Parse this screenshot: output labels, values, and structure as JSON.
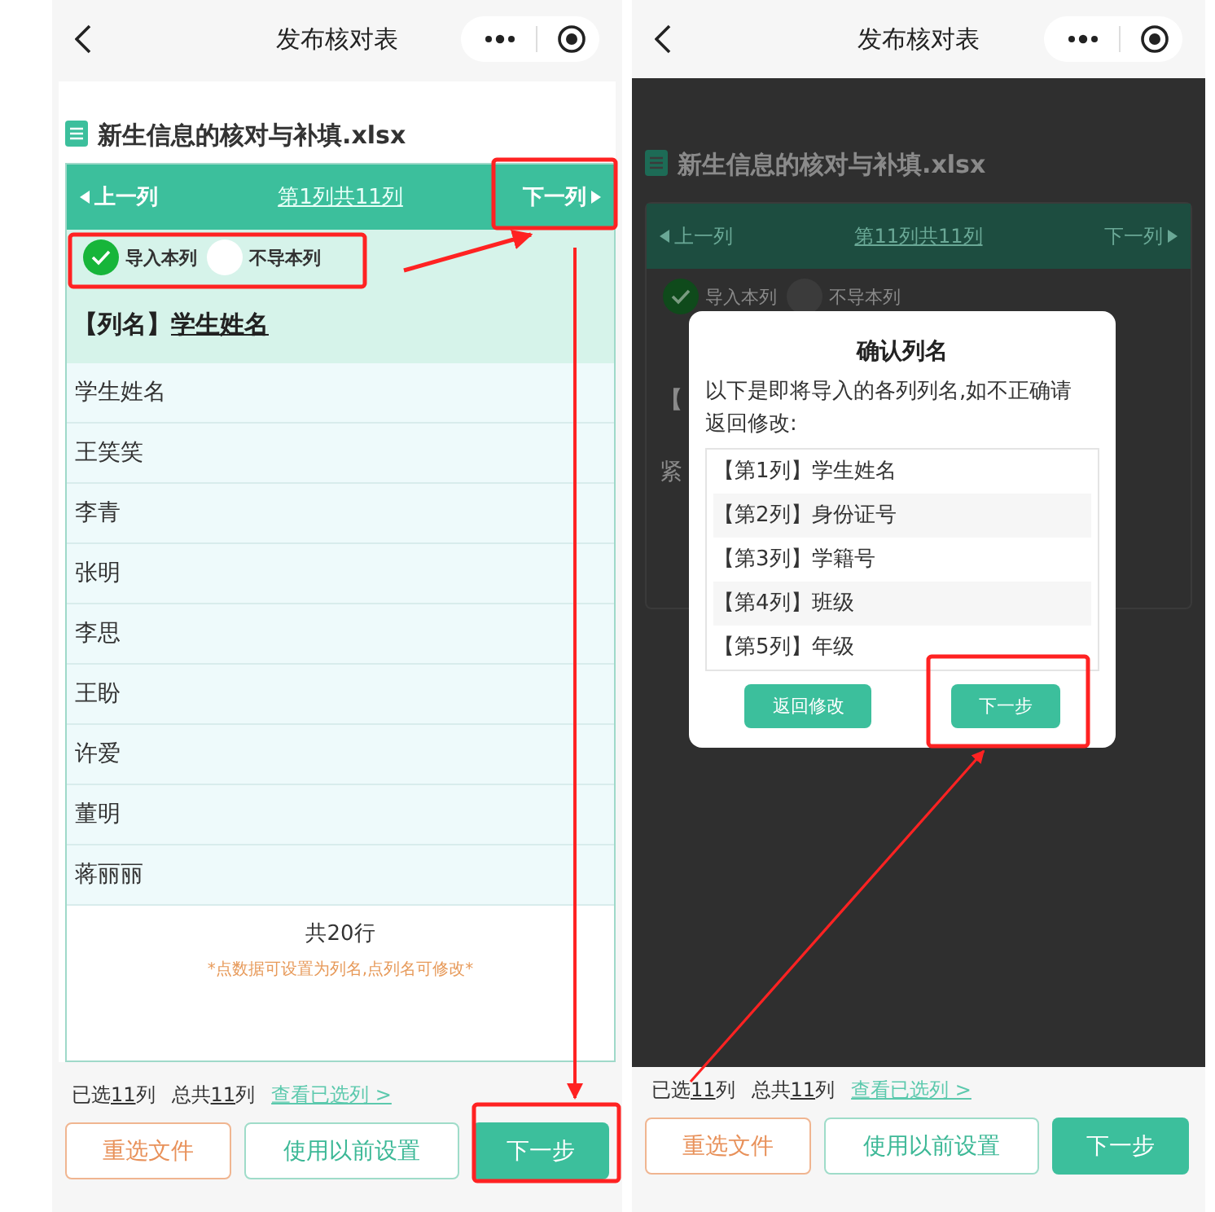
{
  "phones": [
    {
      "kind": "editor",
      "nav": {
        "title": "发布核对表"
      },
      "file_name": "新生信息的核对与补填.xlsx",
      "column_nav": {
        "prev": "上一列",
        "position": "第1列共11列",
        "next": "下一列"
      },
      "import_options": [
        {
          "label": "导入本列",
          "selected": true
        },
        {
          "label": "不导本列",
          "selected": false
        }
      ],
      "column_name": {
        "label": "【列名】",
        "value": "学生姓名"
      },
      "rows": [
        "学生姓名",
        "王笑笑",
        "李青",
        "张明",
        "李思",
        "王盼",
        "许爱",
        "董明",
        "蒋丽丽"
      ],
      "row_total": "共20行",
      "hint": "*点数据可设置为列名,点列名可修改*",
      "summary": {
        "selected_label": "已选",
        "selected_count": "11",
        "selected_unit": "列",
        "total_label": "总共",
        "total_count": "11",
        "total_unit": "列",
        "link": "查看已选列 >"
      },
      "buttons": [
        {
          "label": "重选文件",
          "kind": "warn"
        },
        {
          "label": "使用以前设置",
          "kind": "plain"
        },
        {
          "label": "下一步",
          "kind": "primary"
        }
      ]
    },
    {
      "kind": "confirm",
      "nav": {
        "title": "发布核对表"
      },
      "file_name": "新生信息的核对与补填.xlsx",
      "column_nav": {
        "prev": "上一列",
        "position": "第11列共11列",
        "next": "下一列"
      },
      "import_options": [
        {
          "label": "导入本列",
          "selected": true
        },
        {
          "label": "不导本列",
          "selected": false
        }
      ],
      "background_fragments": [
        "【",
        "紧"
      ],
      "dialog": {
        "title": "确认列名",
        "message": "以下是即将导入的各列列名,如不正确请返回修改:",
        "items": [
          "【第1列】学生姓名",
          "【第2列】身份证号",
          "【第3列】学籍号",
          "【第4列】班级",
          "【第5列】年级"
        ],
        "buttons": [
          {
            "label": "返回修改",
            "kind": "back"
          },
          {
            "label": "下一步",
            "kind": "next"
          }
        ]
      },
      "summary": {
        "selected_label": "已选",
        "selected_count": "11",
        "selected_unit": "列",
        "total_label": "总共",
        "total_count": "11",
        "total_unit": "列",
        "link": "查看已选列 >"
      },
      "buttons": [
        {
          "label": "重选文件",
          "kind": "warn"
        },
        {
          "label": "使用以前设置",
          "kind": "plain"
        },
        {
          "label": "下一步",
          "kind": "primary"
        }
      ]
    }
  ]
}
